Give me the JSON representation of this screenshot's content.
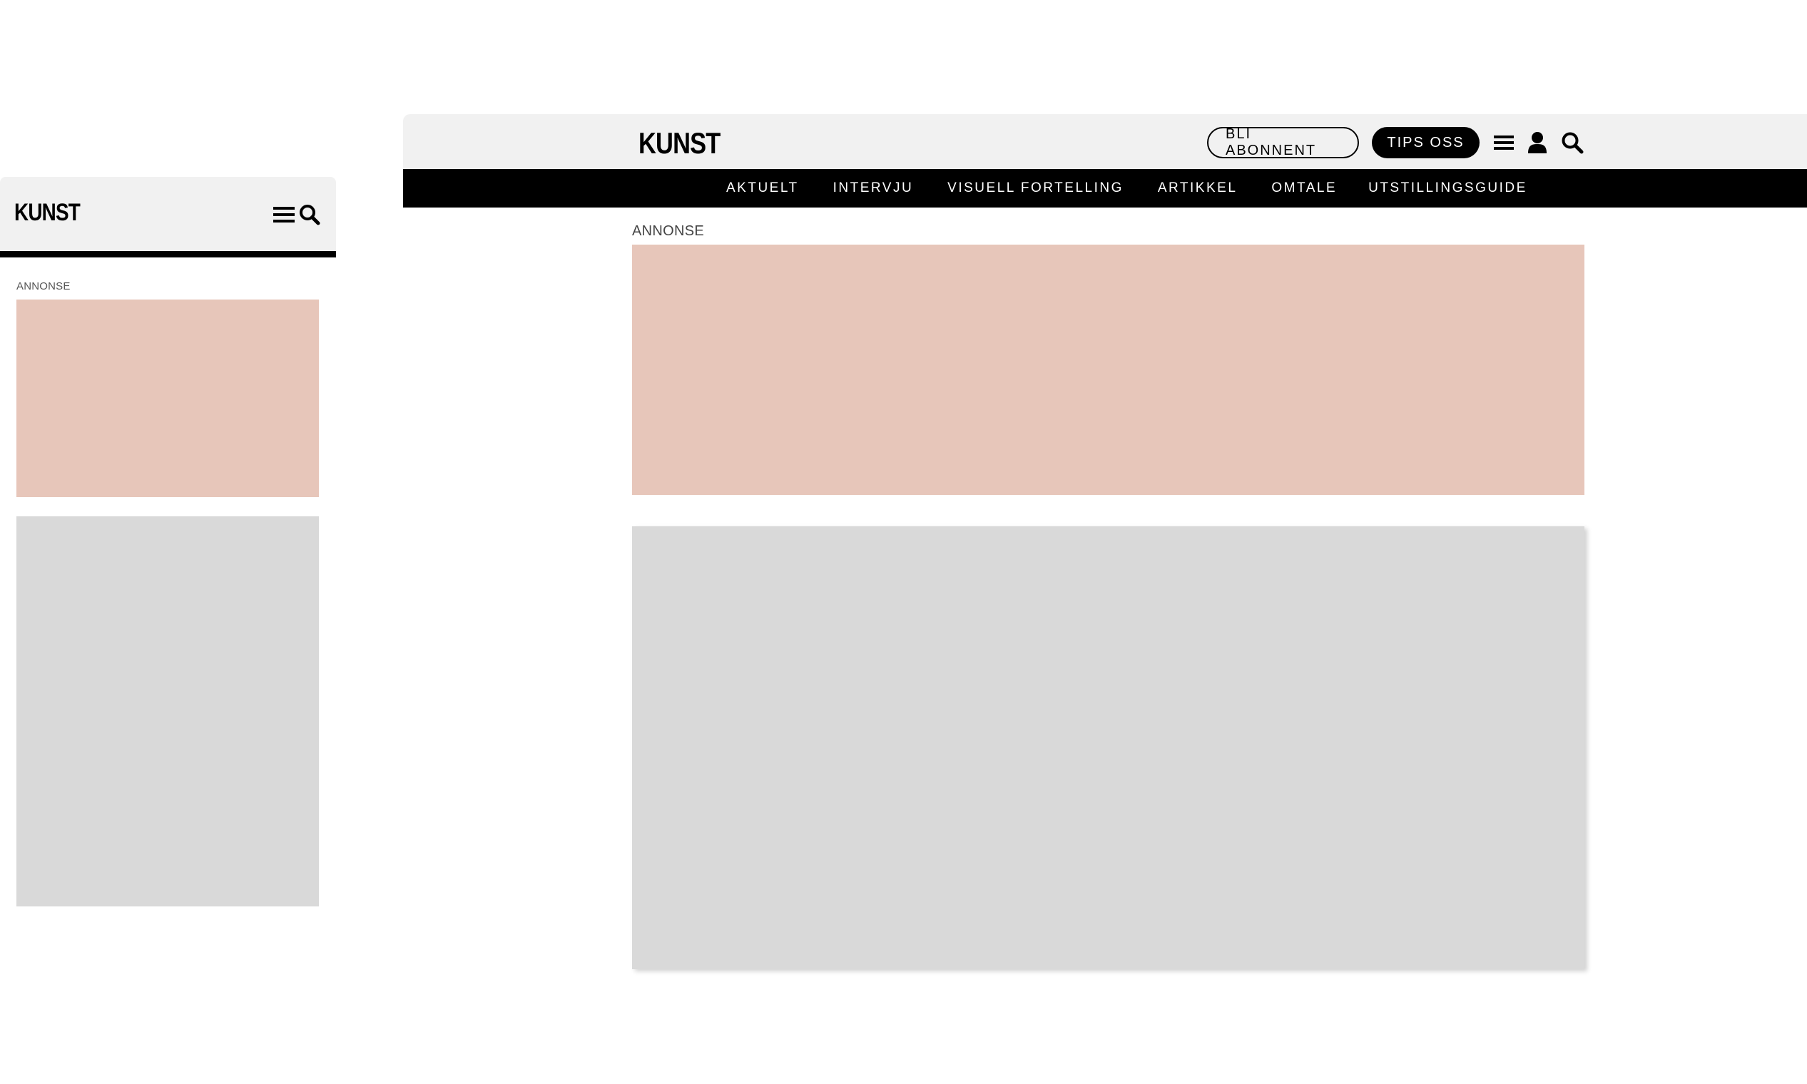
{
  "mobile": {
    "logo": "KUNST",
    "icons": [
      "menu-icon",
      "search-icon"
    ],
    "ad_label": "ANNONSE"
  },
  "desktop": {
    "logo": "KUNST",
    "subscribe_label": "BLI ABONNENT",
    "tips_label": "TIPS OSS",
    "icons": [
      "menu-icon",
      "user-icon",
      "search-icon"
    ],
    "nav": [
      {
        "label": "AKTUELT"
      },
      {
        "label": "INTERVJU"
      },
      {
        "label": "VISUELL FORTELLING"
      },
      {
        "label": "ARTIKKEL"
      },
      {
        "label": "OMTALE"
      },
      {
        "label": "UTSTILLINGSGUIDE"
      }
    ],
    "ad_label": "ANNONSE"
  },
  "colors": {
    "ad_placeholder": "#e7c6ba",
    "content_placeholder": "#d9d9d9",
    "header_bg": "#f1f1f1",
    "nav_bg": "#000000"
  }
}
